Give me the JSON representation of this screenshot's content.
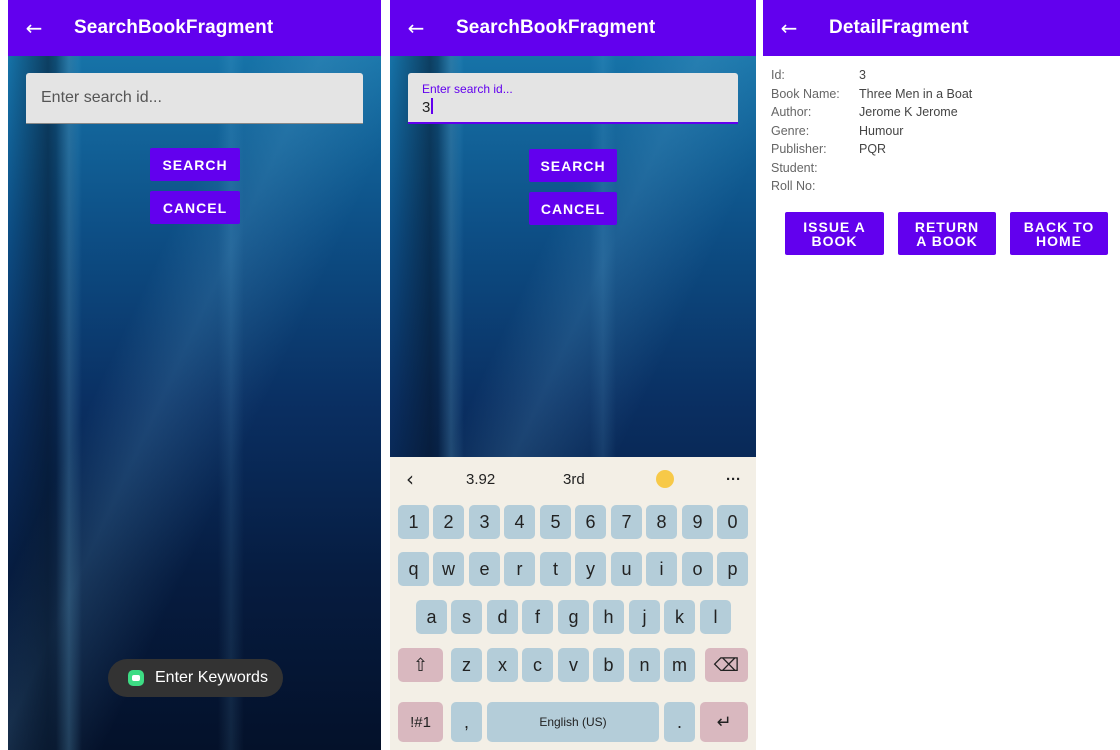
{
  "panel1": {
    "title": "SearchBookFragment",
    "search_placeholder": "Enter search id...",
    "search_button": "SEARCH",
    "cancel_button": "CANCEL",
    "toast_text": "Enter Keywords"
  },
  "panel2": {
    "title": "SearchBookFragment",
    "search_label": "Enter search id...",
    "search_value": "3",
    "search_button": "SEARCH",
    "cancel_button": "CANCEL",
    "keyboard": {
      "suggestions": [
        "3.92",
        "3rd"
      ],
      "number_row": [
        "1",
        "2",
        "3",
        "4",
        "5",
        "6",
        "7",
        "8",
        "9",
        "0"
      ],
      "row1": [
        "q",
        "w",
        "e",
        "r",
        "t",
        "y",
        "u",
        "i",
        "o",
        "p"
      ],
      "row2": [
        "a",
        "s",
        "d",
        "f",
        "g",
        "h",
        "j",
        "k",
        "l"
      ],
      "row3": [
        "z",
        "x",
        "c",
        "v",
        "b",
        "n",
        "m"
      ],
      "symbols_key": "!#1",
      "comma_key": ",",
      "space_label": "English (US)",
      "period_key": "."
    }
  },
  "panel3": {
    "title": "DetailFragment",
    "fields": [
      {
        "label": "Id:",
        "value": "3"
      },
      {
        "label": "Book Name:",
        "value": "Three Men in a Boat"
      },
      {
        "label": "Author:",
        "value": "Jerome K Jerome"
      },
      {
        "label": "Genre:",
        "value": "Humour"
      },
      {
        "label": "Publisher:",
        "value": "PQR"
      },
      {
        "label": "Student:",
        "value": ""
      },
      {
        "label": "Roll No:",
        "value": ""
      }
    ],
    "issue_line1": "ISSUE A",
    "issue_line2": "BOOK",
    "return_line1": "RETURN",
    "return_line2": "A BOOK",
    "home_line1": "BACK TO",
    "home_line2": "HOME"
  },
  "colors": {
    "accent": "#6200ee",
    "toast_bg": "#333333",
    "key_bg": "#b4cdd9",
    "func_key_bg": "#d9b8bf"
  },
  "icons": [
    "back-arrow-icon",
    "chevron-left-icon",
    "emoji-icon",
    "more-icon",
    "shift-icon",
    "backspace-icon",
    "enter-icon"
  ]
}
